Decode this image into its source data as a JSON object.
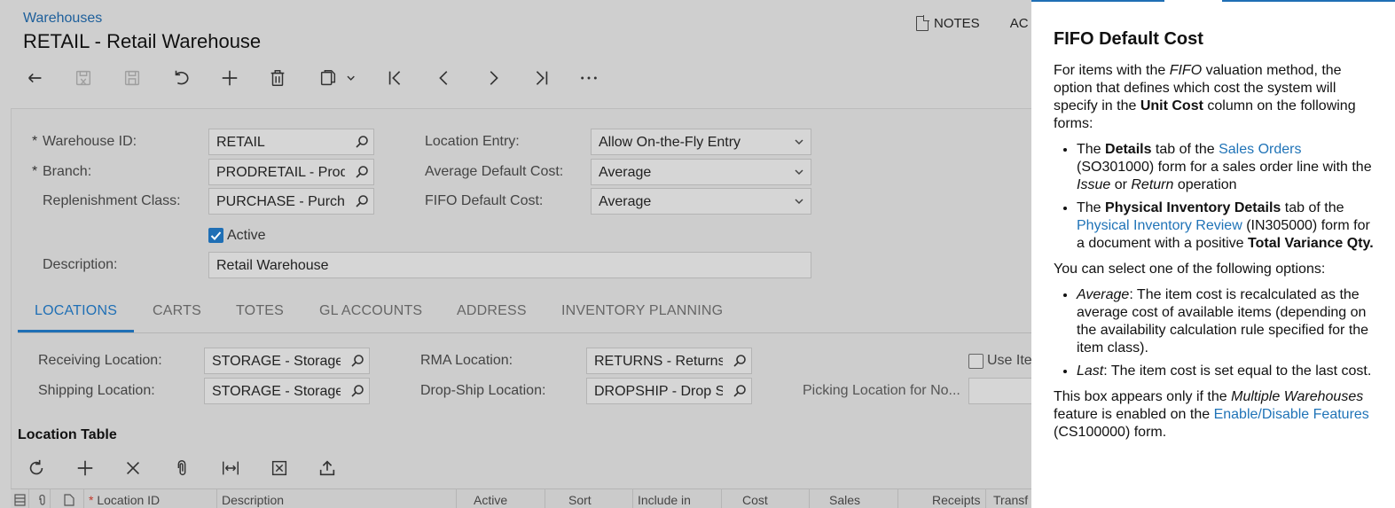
{
  "header": {
    "breadcrumb": "Warehouses",
    "title": "RETAIL - Retail Warehouse",
    "notes_label": "NOTES",
    "actions_label": "AC"
  },
  "toolbar": {
    "icons": [
      "back-icon",
      "save-close-icon",
      "save-icon",
      "undo-icon",
      "add-icon",
      "delete-icon",
      "copy-paste-icon",
      "first-icon",
      "previous-icon",
      "next-icon",
      "last-icon",
      "more-icon"
    ]
  },
  "form": {
    "warehouse_id_label": "Warehouse ID:",
    "warehouse_id_value": "RETAIL",
    "branch_label": "Branch:",
    "branch_value": "PRODRETAIL - Prod",
    "replenishment_label": "Replenishment Class:",
    "replenishment_value": "PURCHASE - Purcha",
    "active_label": "Active",
    "active_checked": true,
    "description_label": "Description:",
    "description_value": "Retail Warehouse",
    "location_entry_label": "Location Entry:",
    "location_entry_value": "Allow On-the-Fly Entry",
    "avg_default_cost_label": "Average Default Cost:",
    "avg_default_cost_value": "Average",
    "fifo_default_cost_label": "FIFO Default Cost:",
    "fifo_default_cost_value": "Average"
  },
  "tabs": [
    "LOCATIONS",
    "CARTS",
    "TOTES",
    "GL ACCOUNTS",
    "ADDRESS",
    "INVENTORY PLANNING"
  ],
  "locations": {
    "receiving_label": "Receiving Location:",
    "receiving_value": "STORAGE - Storage",
    "shipping_label": "Shipping Location:",
    "shipping_value": "STORAGE - Storage",
    "rma_label": "RMA Location:",
    "rma_value": "RETURNS - Returns",
    "dropship_label": "Drop-Ship Location:",
    "dropship_value": "DROPSHIP - Drop S",
    "use_item_label": "Use Ite",
    "picking_label": "Picking Location for No..."
  },
  "location_table": {
    "title": "Location Table",
    "toolbar_icons": [
      "refresh-icon",
      "add-row-icon",
      "delete-row-icon",
      "attach-icon",
      "fit-columns-icon",
      "export-excel-icon",
      "upload-icon"
    ],
    "columns": [
      "Location ID",
      "Description",
      "Active",
      "Sort",
      "Include in",
      "Cost",
      "Sales",
      "Receipts",
      "Transf"
    ]
  },
  "help": {
    "title": "FIFO Default Cost",
    "intro_1": "For items with the ",
    "intro_fifo": "FIFO",
    "intro_2": " valuation method, the option that defines which cost the system will specify in the ",
    "intro_unit_cost": "Unit Cost",
    "intro_3": " column on the following forms:",
    "li1_1": "The ",
    "li1_details": "Details",
    "li1_2": " tab of the ",
    "li1_link": "Sales Orders",
    "li1_3": " (SO301000) form for a sales order line with the ",
    "li1_issue": "Issue",
    "li1_4": " or ",
    "li1_return": "Return",
    "li1_5": " operation",
    "li2_1": "The ",
    "li2_phys": "Physical Inventory Details",
    "li2_2": " tab of the ",
    "li2_link": "Physical Inventory Review",
    "li2_3": " (IN305000) form for a document with a positive ",
    "li2_total": "Total Variance Qty.",
    "options_intro": "You can select one of the following options:",
    "opt1_name": "Average",
    "opt1_text": ": The item cost is recalculated as the average cost of available items (depending on the availability calculation rule specified for the item class).",
    "opt2_name": "Last",
    "opt2_text": ": The item cost is set equal to the last cost.",
    "footer_1": "This box appears only if the ",
    "footer_mw": "Multiple Warehouses",
    "footer_2": " feature is enabled on the ",
    "footer_link": "Enable/Disable Features",
    "footer_3": " (CS100000) form."
  },
  "colors": {
    "accent": "#1f6fb5",
    "link": "#1f73b7",
    "overlay_bg": "#cfcfcf"
  }
}
